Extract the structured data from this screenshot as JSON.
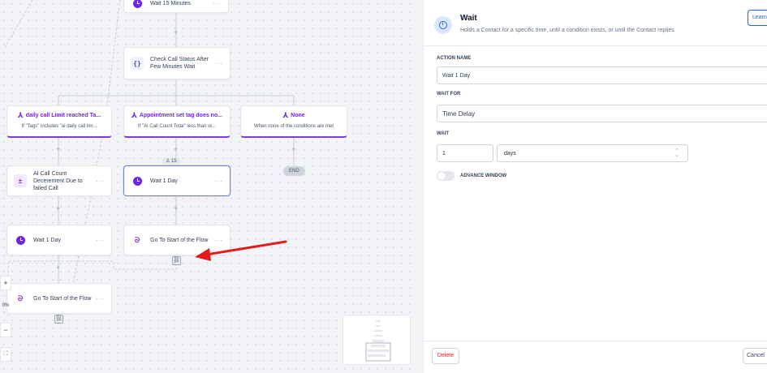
{
  "canvas": {
    "nodes": {
      "wait_15": {
        "label": "Wait 15 Minutes"
      },
      "check_status": {
        "label": "Check Call Status After Few Minutes Wait"
      },
      "ai_count": {
        "label": "AI Call Count Decerement Due to failed Call"
      },
      "wait_1_mid": {
        "label": "Wait 1 Day"
      },
      "wait_1_left": {
        "label": "Wait 1 Day"
      },
      "goto_mid": {
        "label": "Go To Start of the Flow"
      },
      "goto_left": {
        "label": "Go To Start of the Flow"
      }
    },
    "branches": [
      {
        "title": "daily call Limit reached Ta...",
        "subtitle": "If \"Tags\" includes \"ai daily call lim..."
      },
      {
        "title": "Appointment set tag does no...",
        "subtitle": "If \"AI Call Count Total\" less than or..."
      },
      {
        "title": "None",
        "subtitle": "When none of the conditions are met"
      }
    ],
    "end_label": "END",
    "contact_count": "15",
    "more": "···",
    "zoom": {
      "plus": "+",
      "level": "0%",
      "minus": "−",
      "fit": "⛶"
    }
  },
  "panel": {
    "title": "Wait",
    "subtitle": "Holds a Contact for a specific time, until a condition exists, or until the Contact replies",
    "learn_button": "Learn",
    "action_name_label": "ACTION NAME",
    "action_name_value": "Wait 1 Day",
    "wait_for_label": "WAIT FOR",
    "wait_for_value": "Time Delay",
    "wait_label": "WAIT",
    "wait_amount": "1",
    "wait_unit": "days",
    "advance_window_label": "ADVANCE WINDOW",
    "delete_button": "Delete",
    "cancel_button": "Cancel"
  },
  "colors": {
    "accent": "#7c3aed",
    "brand": "#2563eb",
    "danger": "#dc2626",
    "arrow": "#e11d1d"
  }
}
